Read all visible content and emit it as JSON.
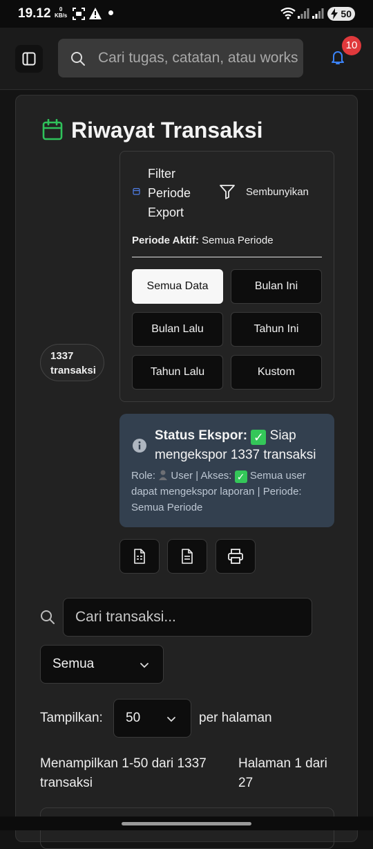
{
  "status_bar": {
    "time": "19.12",
    "net_speed_value": "0",
    "net_speed_unit": "KB/s",
    "battery": "50"
  },
  "header": {
    "search_placeholder": "Cari tugas, catatan, atau workspace...",
    "notification_count": "10"
  },
  "page": {
    "title": "Riwayat Transaksi",
    "count_badge": "1337 transaksi"
  },
  "filter": {
    "title": "Filter Periode Export",
    "hide_label": "Sembunyikan",
    "active_label": "Periode Aktif:",
    "active_value": "Semua Periode",
    "buttons": [
      "Semua Data",
      "Bulan Ini",
      "Bulan Lalu",
      "Tahun Ini",
      "Tahun Lalu",
      "Kustom"
    ],
    "selected": "Semua Data"
  },
  "export_status": {
    "label": "Status Ekspor:",
    "message": "Siap mengekspor 1337 transaksi",
    "role_label": "Role:",
    "role_value": "User",
    "access_label": "Akses:",
    "access_value": "Semua user dapat mengekspor laporan",
    "period_label": "Periode:",
    "period_value": "Semua Periode"
  },
  "export_buttons": [
    "excel-icon",
    "pdf-icon",
    "print-icon"
  ],
  "search": {
    "placeholder": "Cari transaksi..."
  },
  "type_filter": {
    "value": "Semua"
  },
  "pagination": {
    "show_label": "Tampilkan:",
    "page_size": "50",
    "per_page_label": "per halaman",
    "range_text": "Menampilkan 1-50 dari 1337 transaksi",
    "page_text": "Halaman 1 dari 27"
  },
  "colors": {
    "accent_green": "#2fc25b",
    "notification_red": "#e0393c",
    "bell_blue": "#3b82f6",
    "status_box_bg": "#33404f"
  }
}
